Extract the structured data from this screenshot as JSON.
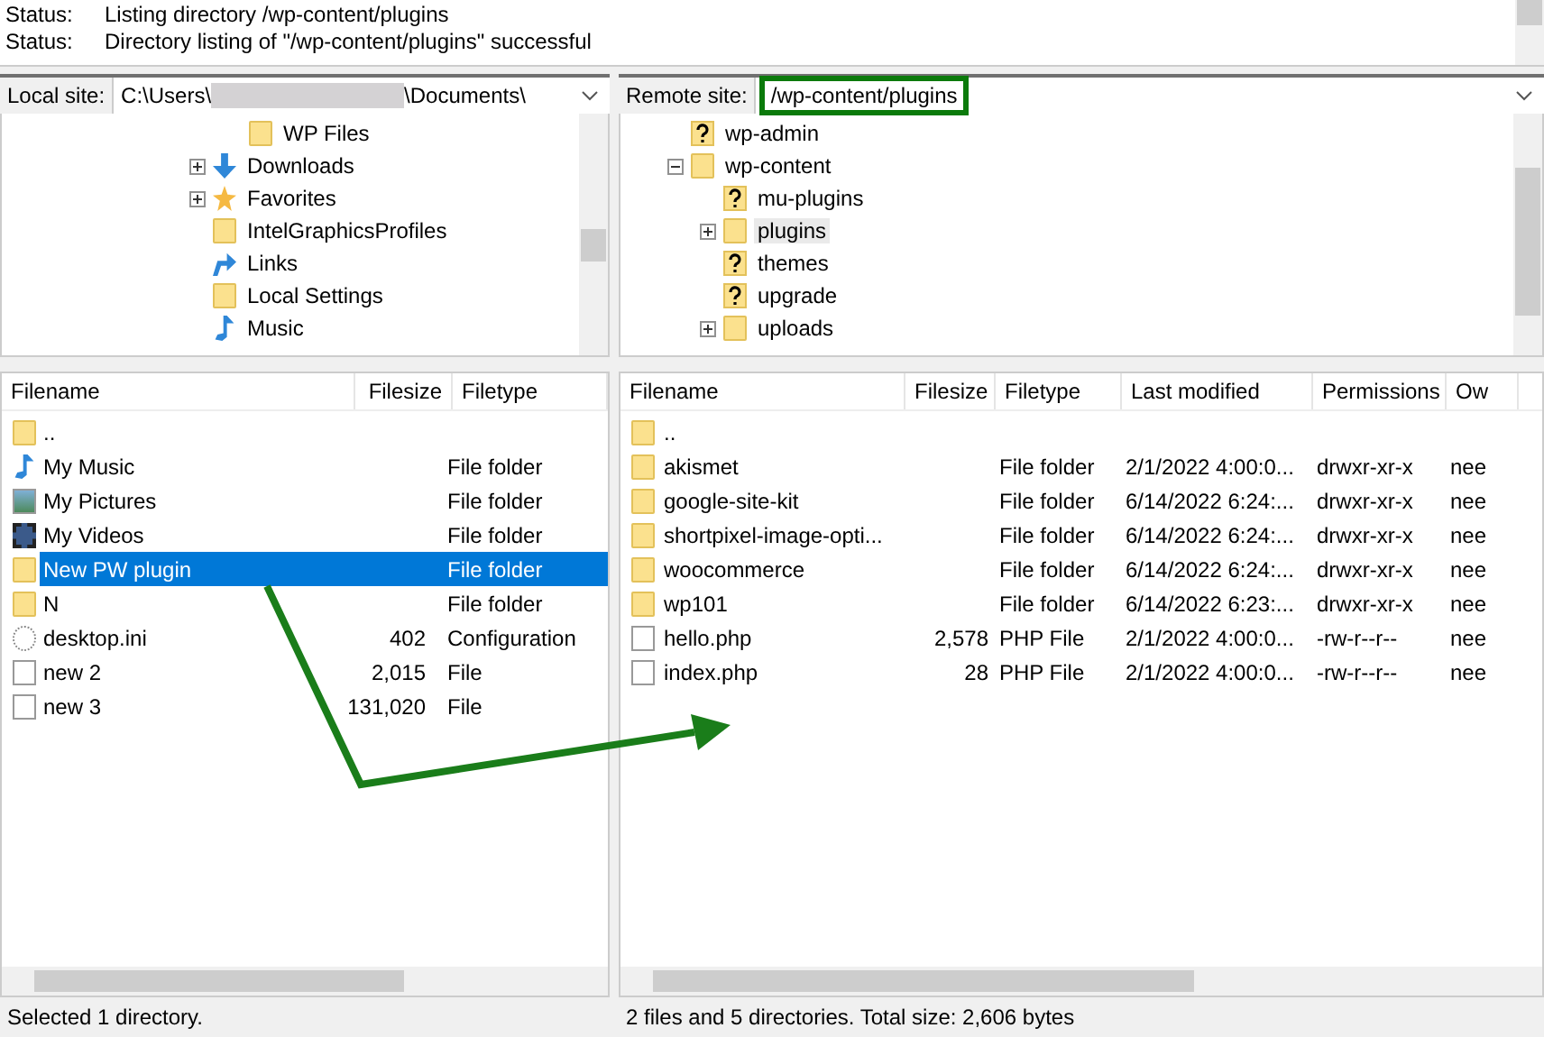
{
  "message_log": [
    {
      "label": "Status:",
      "text": "Listing directory /wp-content/plugins"
    },
    {
      "label": "Status:",
      "text": "Directory listing of \"/wp-content/plugins\" successful"
    }
  ],
  "local_site": {
    "label": "Local site:",
    "path_start": "C:\\Users\\",
    "path_end": "\\Documents\\"
  },
  "local_tree": [
    {
      "label": "WP Files",
      "kind": "folder",
      "expandable": false,
      "nested": true
    },
    {
      "label": "Downloads",
      "kind": "download",
      "expandable": true,
      "nested": false
    },
    {
      "label": "Favorites",
      "kind": "star",
      "expandable": true,
      "nested": false
    },
    {
      "label": "IntelGraphicsProfiles",
      "kind": "folder",
      "expandable": false,
      "nested": false
    },
    {
      "label": "Links",
      "kind": "link",
      "expandable": false,
      "nested": false
    },
    {
      "label": "Local Settings",
      "kind": "folder",
      "expandable": false,
      "nested": false
    },
    {
      "label": "Music",
      "kind": "music",
      "expandable": false,
      "nested": false
    }
  ],
  "remote_site": {
    "label": "Remote site:",
    "path": "/wp-content/plugins"
  },
  "remote_tree": [
    {
      "label": "wp-admin",
      "kind": "unknown",
      "expanded": false,
      "selected": false
    },
    {
      "label": "wp-content",
      "kind": "folder",
      "expanded": true,
      "selected": false,
      "children": [
        {
          "label": "mu-plugins",
          "kind": "unknown",
          "expandable": false,
          "selected": false
        },
        {
          "label": "plugins",
          "kind": "folder",
          "expandable": true,
          "selected": true
        },
        {
          "label": "themes",
          "kind": "unknown",
          "expandable": false,
          "selected": false
        },
        {
          "label": "upgrade",
          "kind": "unknown",
          "expandable": false,
          "selected": false
        },
        {
          "label": "uploads",
          "kind": "folder",
          "expandable": true,
          "selected": false
        }
      ]
    }
  ],
  "local_files": {
    "columns": [
      "Filename",
      "Filesize",
      "Filetype"
    ],
    "rows": [
      {
        "kind": "folder",
        "name": "..",
        "size": "",
        "type": "",
        "selected": false
      },
      {
        "kind": "music",
        "name": "My Music",
        "size": "",
        "type": "File folder",
        "selected": false
      },
      {
        "kind": "picture",
        "name": "My Pictures",
        "size": "",
        "type": "File folder",
        "selected": false
      },
      {
        "kind": "video",
        "name": "My Videos",
        "size": "",
        "type": "File folder",
        "selected": false
      },
      {
        "kind": "folder",
        "name": "New PW plugin",
        "size": "",
        "type": "File folder",
        "selected": true
      },
      {
        "kind": "folder",
        "name": "N",
        "size": "",
        "type": "File folder",
        "selected": false
      },
      {
        "kind": "settings",
        "name": "desktop.ini",
        "size": "402",
        "type": "Configuration",
        "selected": false
      },
      {
        "kind": "file",
        "name": "new 2",
        "size": "2,015",
        "type": "File",
        "selected": false
      },
      {
        "kind": "file",
        "name": "new 3",
        "size": "131,020",
        "type": "File",
        "selected": false
      }
    ]
  },
  "remote_files": {
    "columns": [
      "Filename",
      "Filesize",
      "Filetype",
      "Last modified",
      "Permissions",
      "Ow"
    ],
    "rows": [
      {
        "kind": "folder",
        "cells": [
          "..",
          "",
          "",
          "",
          "",
          ""
        ]
      },
      {
        "kind": "folder",
        "cells": [
          "akismet",
          "",
          "File folder",
          "2/1/2022 4:00:0...",
          "drwxr-xr-x",
          "nee"
        ]
      },
      {
        "kind": "folder",
        "cells": [
          "google-site-kit",
          "",
          "File folder",
          "6/14/2022 6:24:...",
          "drwxr-xr-x",
          "nee"
        ]
      },
      {
        "kind": "folder",
        "cells": [
          "shortpixel-image-opti...",
          "",
          "File folder",
          "6/14/2022 6:24:...",
          "drwxr-xr-x",
          "nee"
        ]
      },
      {
        "kind": "folder",
        "cells": [
          "woocommerce",
          "",
          "File folder",
          "6/14/2022 6:24:...",
          "drwxr-xr-x",
          "nee"
        ]
      },
      {
        "kind": "folder",
        "cells": [
          "wp101",
          "",
          "File folder",
          "6/14/2022 6:23:...",
          "drwxr-xr-x",
          "nee"
        ]
      },
      {
        "kind": "file",
        "cells": [
          "hello.php",
          "2,578",
          "PHP File",
          "2/1/2022 4:00:0...",
          "-rw-r--r--",
          "nee"
        ]
      },
      {
        "kind": "file",
        "cells": [
          "index.php",
          "28",
          "PHP File",
          "2/1/2022 4:00:0...",
          "-rw-r--r--",
          "nee"
        ]
      }
    ]
  },
  "local_status": "Selected 1 directory.",
  "remote_status": "2 files and 5 directories. Total size: 2,606 bytes"
}
